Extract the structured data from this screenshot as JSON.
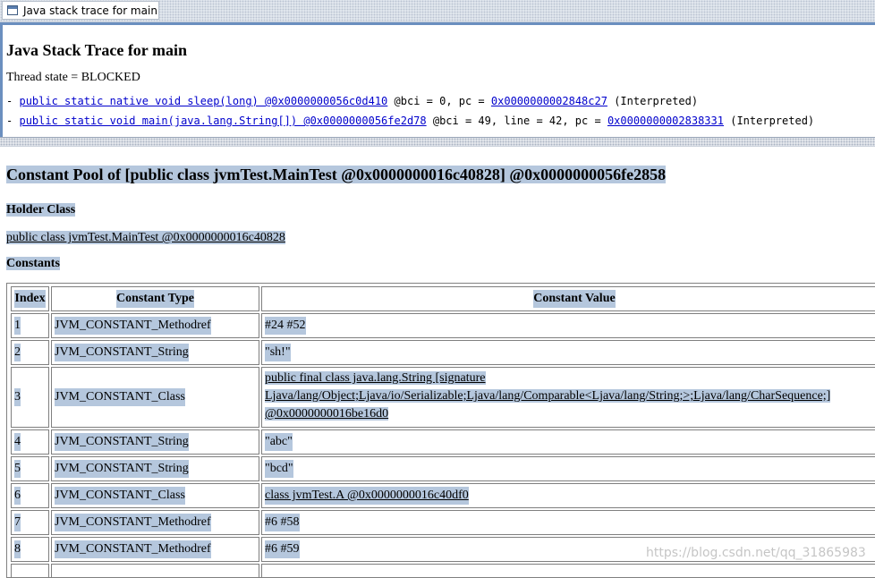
{
  "window": {
    "title": "Java stack trace for main",
    "icon": "window-icon"
  },
  "stack": {
    "heading": "Java Stack Trace for main",
    "thread_state": "Thread state = BLOCKED",
    "frames": [
      {
        "bullet": "-",
        "method": "public static native void sleep(long) @0x0000000056c0d410",
        "mid": "@bci = 0, pc =",
        "pc": "0x0000000002848c27",
        "suffix": "(Interpreted)"
      },
      {
        "bullet": "-",
        "method": "public static void main(java.lang.String[]) @0x0000000056fe2d78",
        "mid": "@bci = 49, line = 42, pc =",
        "pc": "0x0000000002838331",
        "suffix": "(Interpreted)"
      }
    ]
  },
  "pool": {
    "title": "Constant Pool of [public class jvmTest.MainTest @0x0000000016c40828] @0x0000000056fe2858",
    "holder_heading": "Holder Class",
    "holder_value": "public class jvmTest.MainTest @0x0000000016c40828",
    "constants_heading": "Constants",
    "columns": [
      "Index",
      "Constant Type",
      "Constant Value"
    ],
    "rows": [
      {
        "index": "1",
        "type": "JVM_CONSTANT_Methodref",
        "value": "#24 #52"
      },
      {
        "index": "2",
        "type": "JVM_CONSTANT_String",
        "value": "\"sh!\""
      },
      {
        "index": "3",
        "type": "JVM_CONSTANT_Class",
        "value_lines": [
          "public final class java.lang.String [signature",
          "Ljava/lang/Object;Ljava/io/Serializable;Ljava/lang/Comparable<Ljava/lang/String;>;Ljava/lang/CharSequence;]",
          "@0x0000000016be16d0"
        ]
      },
      {
        "index": "4",
        "type": "JVM_CONSTANT_String",
        "value": "\"abc\""
      },
      {
        "index": "5",
        "type": "JVM_CONSTANT_String",
        "value": "\"bcd\""
      },
      {
        "index": "6",
        "type": "JVM_CONSTANT_Class",
        "value": "class jvmTest.A @0x0000000016c40df0"
      },
      {
        "index": "7",
        "type": "JVM_CONSTANT_Methodref",
        "value": "#6 #58"
      },
      {
        "index": "8",
        "type": "JVM_CONSTANT_Methodref",
        "value": "#6 #59"
      }
    ]
  },
  "watermark": "https://blog.csdn.net/qq_31865983"
}
